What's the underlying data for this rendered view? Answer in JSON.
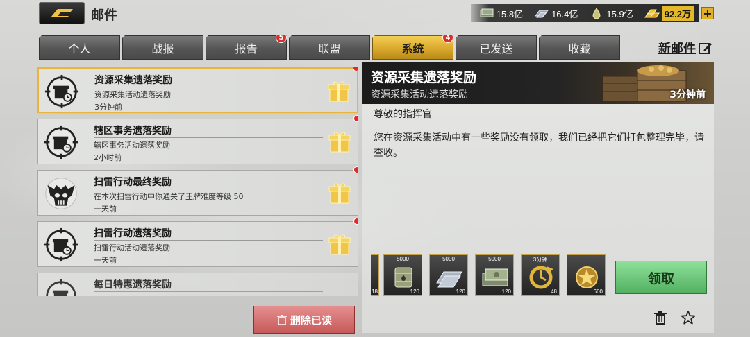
{
  "header": {
    "title": "邮件",
    "resources": [
      {
        "icon": "cash-stack-icon",
        "value": "15.8亿"
      },
      {
        "icon": "steel-bars-icon",
        "value": "16.4亿"
      },
      {
        "icon": "oil-icon",
        "value": "15.9亿"
      },
      {
        "icon": "gold-bars-icon",
        "value": "92.2万"
      }
    ],
    "add_label": "+"
  },
  "tabs": [
    {
      "label": "个人",
      "badge": null
    },
    {
      "label": "战报",
      "badge": null
    },
    {
      "label": "报告",
      "badge": "5"
    },
    {
      "label": "联盟",
      "badge": null
    },
    {
      "label": "系统",
      "badge": "4",
      "active": true
    },
    {
      "label": "已发送",
      "badge": null
    },
    {
      "label": "收藏",
      "badge": null
    }
  ],
  "new_mail_label": "新邮件",
  "mails": [
    {
      "title": "资源采集遗落奖励",
      "subtitle": "资源采集活动遗落奖励",
      "time": "3分钟前",
      "icon": "gift-crosshair-icon"
    },
    {
      "title": "辖区事务遗落奖励",
      "subtitle": "辖区事务活动遗落奖励",
      "time": "2小时前",
      "icon": "gift-crosshair-icon"
    },
    {
      "title": "扫雷行动最终奖励",
      "subtitle": "在本次扫雷行动中你通关了王牌难度等级 50",
      "time": "一天前",
      "icon": "skull-emblem-icon"
    },
    {
      "title": "扫雷行动遗落奖励",
      "subtitle": "扫雷行动活动遗落奖励",
      "time": "一天前",
      "icon": "gift-crosshair-icon"
    },
    {
      "title": "每日特惠遗落奖励",
      "subtitle": "",
      "time": "",
      "icon": "gift-crosshair-icon"
    }
  ],
  "delete_read_label": "删除已读",
  "detail": {
    "title": "资源采集遗落奖励",
    "subtitle": "资源采集活动遗落奖励",
    "time": "3分钟前",
    "greeting": "尊敬的指挥官",
    "body": "您在资源采集活动中有一些奖励没有领取，我们已经把它们打包整理完毕，请查收。",
    "rewards": [
      {
        "label": "",
        "count": "18",
        "icon": "partial-item-icon"
      },
      {
        "label": "5000",
        "count": "120",
        "icon": "oil-barrel-icon"
      },
      {
        "label": "5000",
        "count": "120",
        "icon": "steel-bars-icon"
      },
      {
        "label": "5000",
        "count": "120",
        "icon": "cash-stack-icon"
      },
      {
        "label": "3分钟",
        "count": "48",
        "icon": "speedup-icon"
      },
      {
        "label": "",
        "count": "600",
        "icon": "star-medal-icon"
      }
    ],
    "claim_label": "领取"
  }
}
